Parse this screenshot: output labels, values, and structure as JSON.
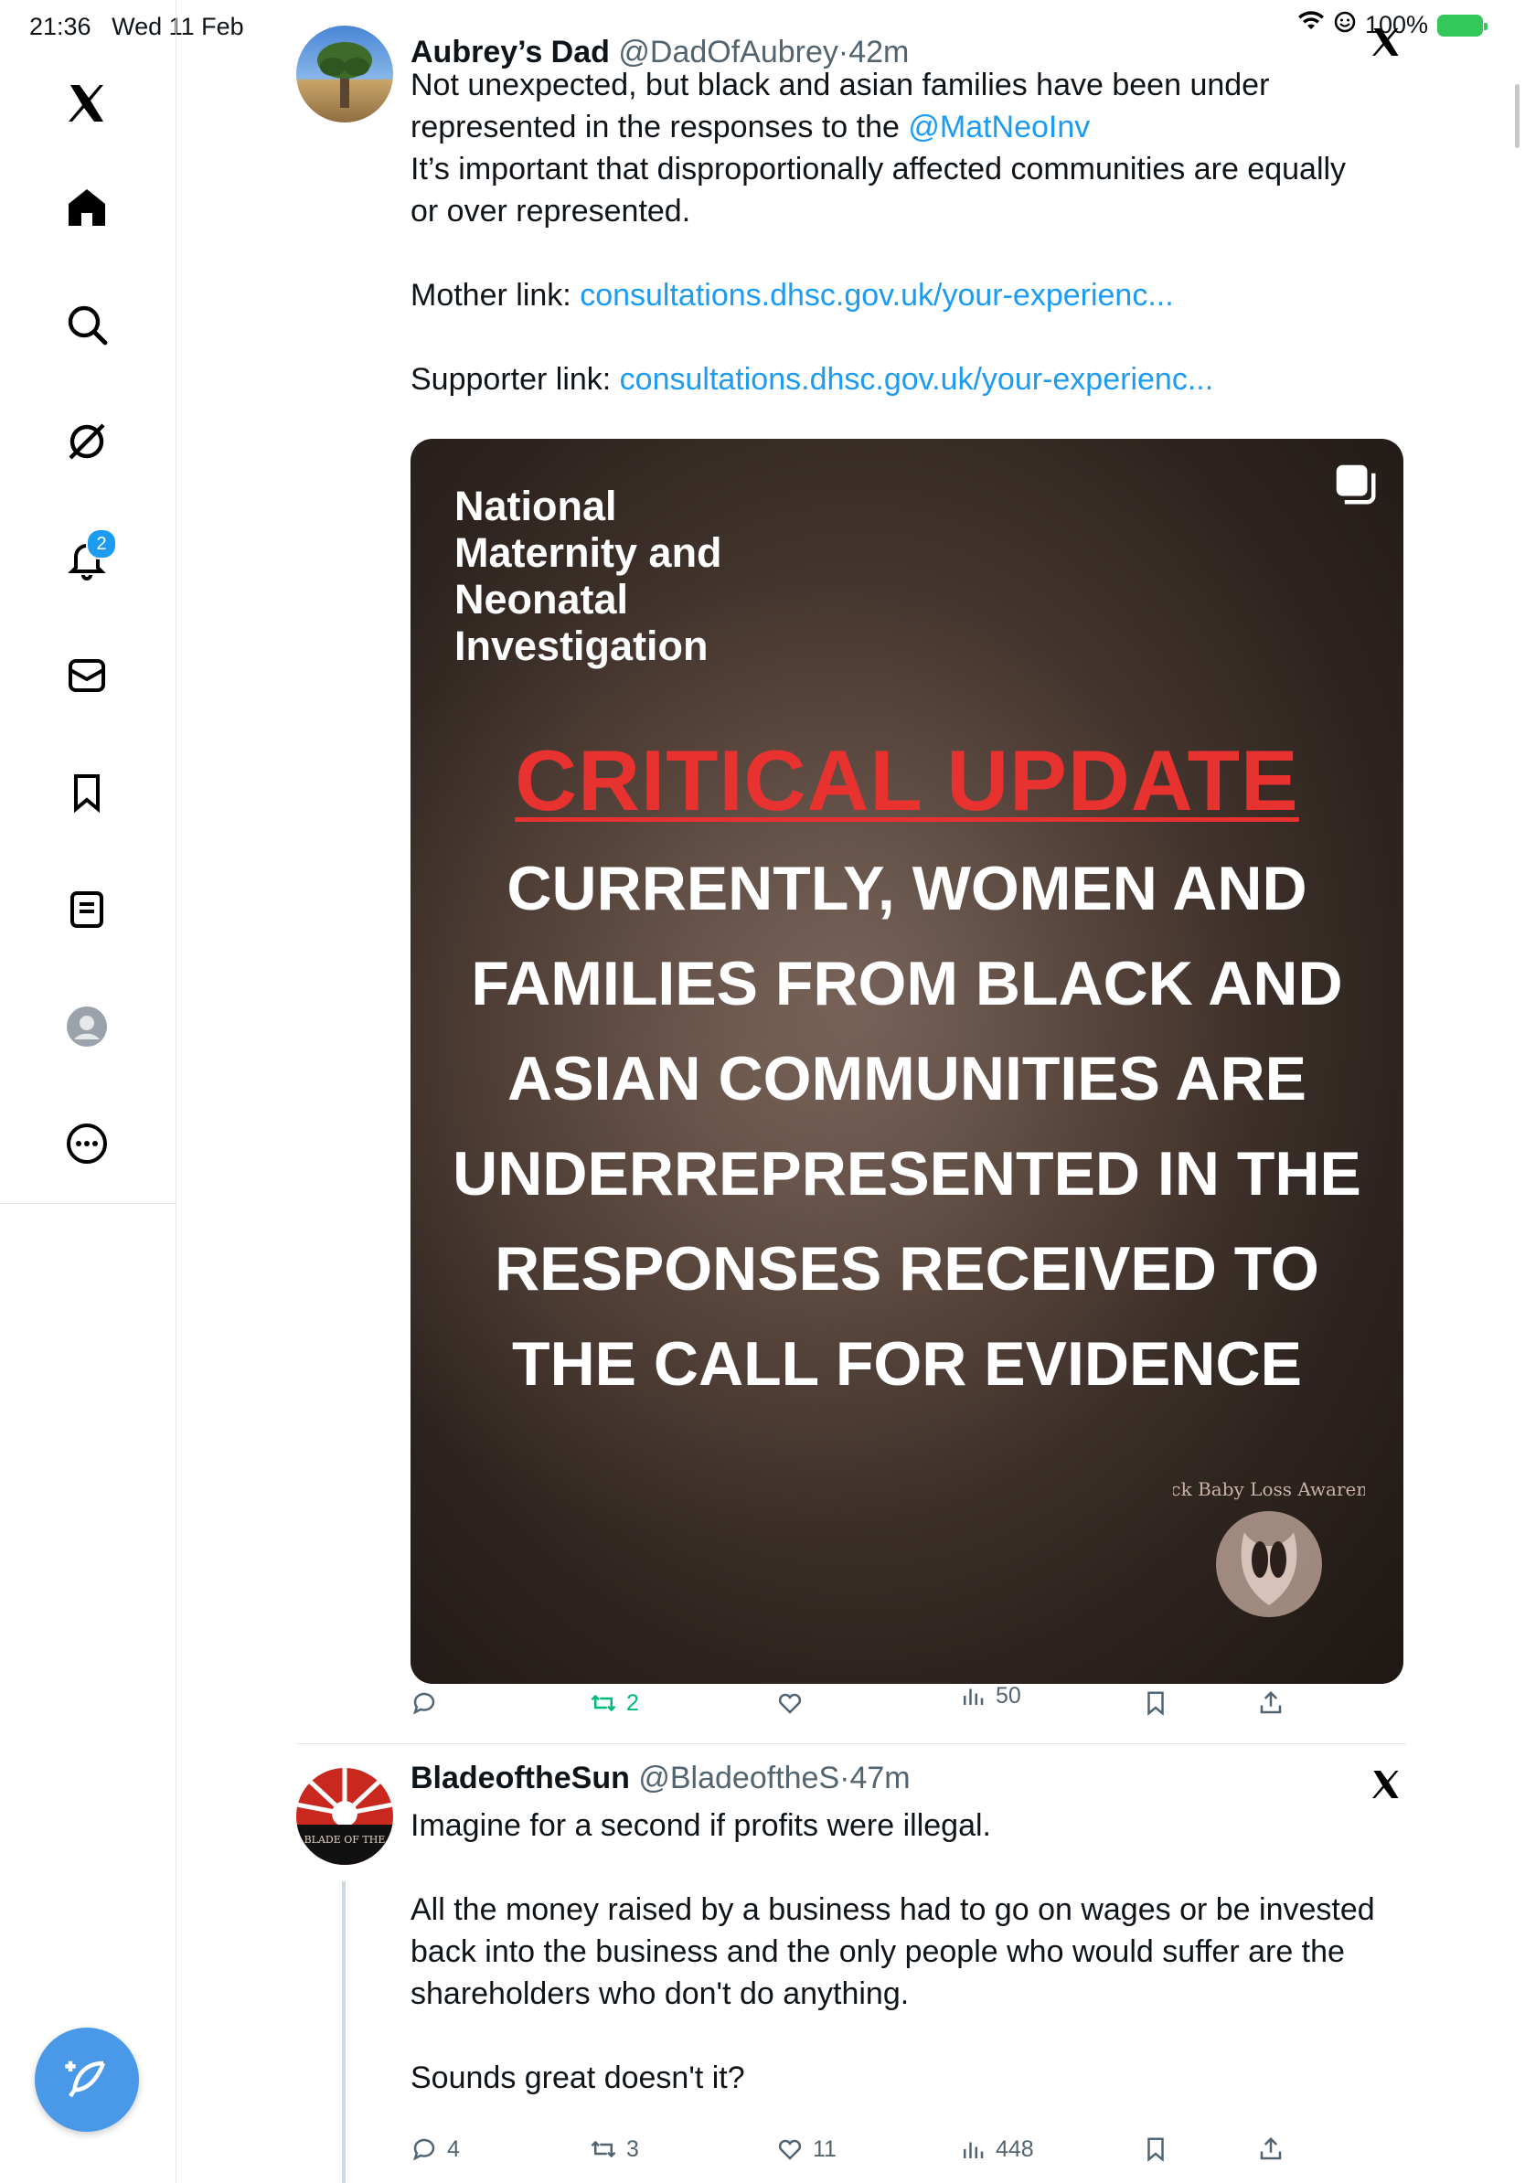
{
  "status_bar": {
    "time": "21:36",
    "date": "Wed 11 Feb",
    "battery": "100%"
  },
  "sidebar": {
    "items": [
      {
        "name": "x-logo"
      },
      {
        "name": "home"
      },
      {
        "name": "search"
      },
      {
        "name": "grok"
      },
      {
        "name": "notifications",
        "badge": "2"
      },
      {
        "name": "messages"
      },
      {
        "name": "bookmarks"
      },
      {
        "name": "lists"
      },
      {
        "name": "profile"
      },
      {
        "name": "more"
      }
    ]
  },
  "tweets": [
    {
      "name": "Aubrey’s Dad",
      "handle": "@DadOfAubrey",
      "sep": "·",
      "time": "42m",
      "text": {
        "l1": "Not unexpected, but black and asian families have been under",
        "l2_pre": "represented in the responses to the ",
        "mention": "@MatNeoInv",
        "l3": "It’s important that disproportionally affected communities are equally",
        "l4": "or  over represented.",
        "mother_label": "Mother link: ",
        "mother_link": "consultations.dhsc.gov.uk/your-experienc...",
        "supporter_label": "Supporter link: ",
        "supporter_link": "consultations.dhsc.gov.uk/your-experienc..."
      },
      "media": {
        "org": "National\nMaternity and\nNeonatal\nInvestigation",
        "headline": "CRITICAL UPDATE",
        "message": "CURRENTLY, WOMEN AND FAMILIES FROM BLACK AND ASIAN COMMUNITIES ARE UNDERREPRESENTED IN THE RESPONSES RECEIVED TO THE CALL FOR EVIDENCE",
        "logo_text": "Black Baby Loss Awareness"
      },
      "stats": {
        "replies": "",
        "retweets": "2",
        "likes": "",
        "views": "50"
      }
    },
    {
      "name": "BladeoftheSun",
      "handle": "@BladeoftheS",
      "sep": "·",
      "time": "47m",
      "text": {
        "p1": "Imagine for a second if profits were illegal.",
        "p2": "All the money raised by a business had to go on wages or be invested back into the business and the only people who would suffer are the shareholders who don't do anything.",
        "p3": "Sounds great doesn't it?"
      },
      "avatar_text": "BLADE OF THE",
      "stats": {
        "replies": "4",
        "retweets": "3",
        "likes": "11",
        "views": "448"
      }
    }
  ],
  "colors": {
    "accent": "#1d9bf0",
    "retweet": "#00ba7c",
    "critical": "#e8322f"
  }
}
